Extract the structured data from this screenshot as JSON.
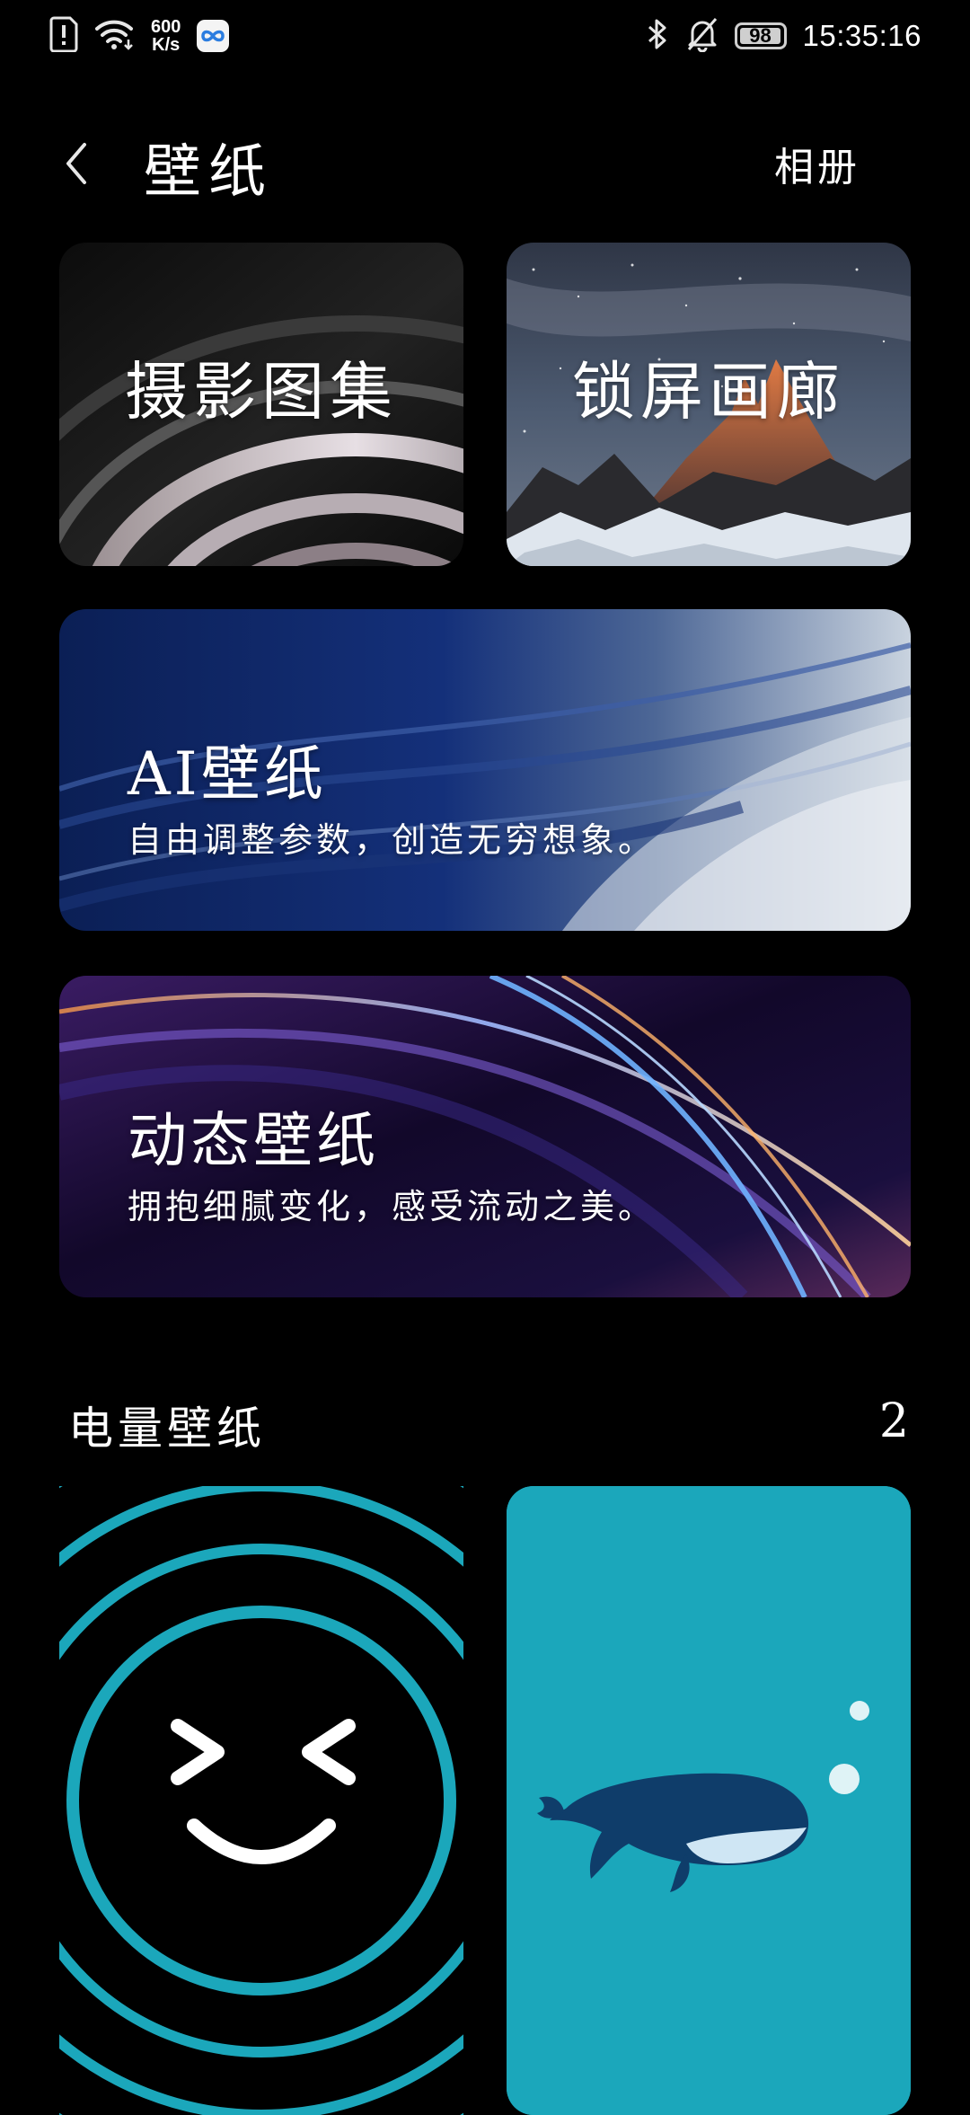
{
  "status_bar": {
    "speed_value": "600",
    "speed_unit": "K/s",
    "battery_level": 98,
    "battery_text": "98",
    "time": "15:35:16",
    "icons": [
      "sim-alert-icon",
      "wifi-icon",
      "infinity-app-icon",
      "bluetooth-icon",
      "bell-muted-icon",
      "battery-icon"
    ]
  },
  "header": {
    "title": "壁纸",
    "album_label": "相册",
    "back_icon": "chevron-left-icon"
  },
  "cards": {
    "photo_gallery": {
      "title": "摄影图集"
    },
    "lock_screen": {
      "title": "锁屏画廊"
    },
    "ai_wallpaper": {
      "title": "AI壁纸",
      "subtitle": "自由调整参数，创造无穷想象。"
    },
    "live_wallpaper": {
      "title": "动态壁纸",
      "subtitle": "拥抱细腻变化，感受流动之美。"
    }
  },
  "battery_section": {
    "title": "电量壁纸",
    "count": "2",
    "items": [
      "smiley-face-icon",
      "whale-icon"
    ]
  },
  "colors": {
    "background": "#000000",
    "teal": "#1ba7bb",
    "whale": "#0f3d6a"
  }
}
